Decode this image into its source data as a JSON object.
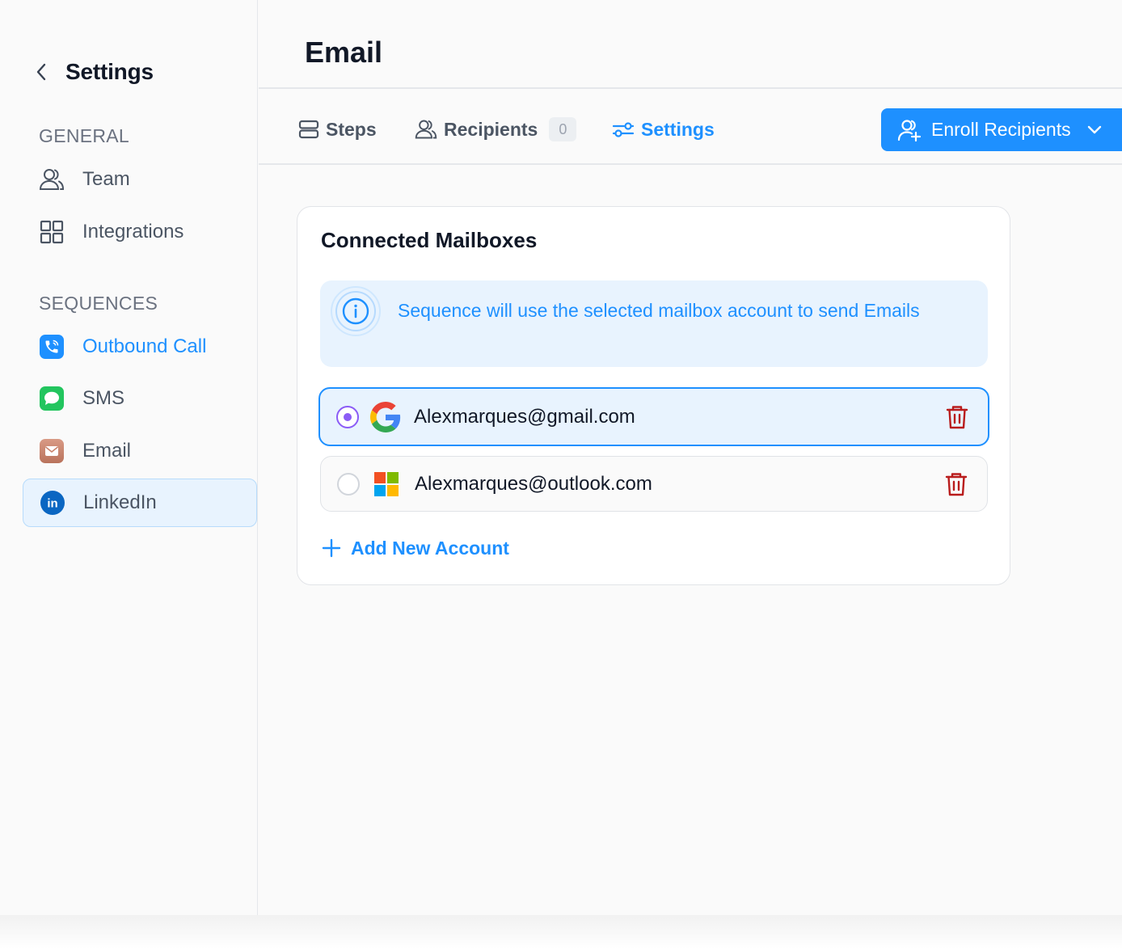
{
  "sidebar": {
    "title": "Settings",
    "sections": {
      "general": "GENERAL",
      "sequences": "SEQUENCES"
    },
    "items": [
      {
        "label": "Team",
        "icon": "users-icon"
      },
      {
        "label": "Integrations",
        "icon": "grid-icon"
      },
      {
        "label": "Outbound Call",
        "icon": "phone-icon"
      },
      {
        "label": "SMS",
        "icon": "message-icon"
      },
      {
        "label": "Email",
        "icon": "mail-icon"
      },
      {
        "label": "LinkedIn",
        "icon": "linkedin-icon"
      }
    ]
  },
  "header": {
    "title": "Email"
  },
  "tabs": [
    {
      "label": "Steps",
      "icon": "steps-icon"
    },
    {
      "label": "Recipients",
      "icon": "users-icon",
      "count": "0"
    },
    {
      "label": "Settings",
      "icon": "sliders-icon"
    }
  ],
  "enroll_button": {
    "label": "Enroll Recipients"
  },
  "card": {
    "title": "Connected Mailboxes",
    "info": "Sequence will use the selected mailbox account to send Emails",
    "mailboxes": [
      {
        "email": "Alexmarques@gmail.com",
        "provider_icon": "google-icon",
        "selected": true
      },
      {
        "email": "Alexmarques@outlook.com",
        "provider_icon": "microsoft-icon",
        "selected": false
      }
    ],
    "add_account": "Add New Account"
  },
  "colors": {
    "accent": "#1e90ff",
    "danger": "#b91c1c",
    "radio_selected": "#8b5cf6"
  }
}
